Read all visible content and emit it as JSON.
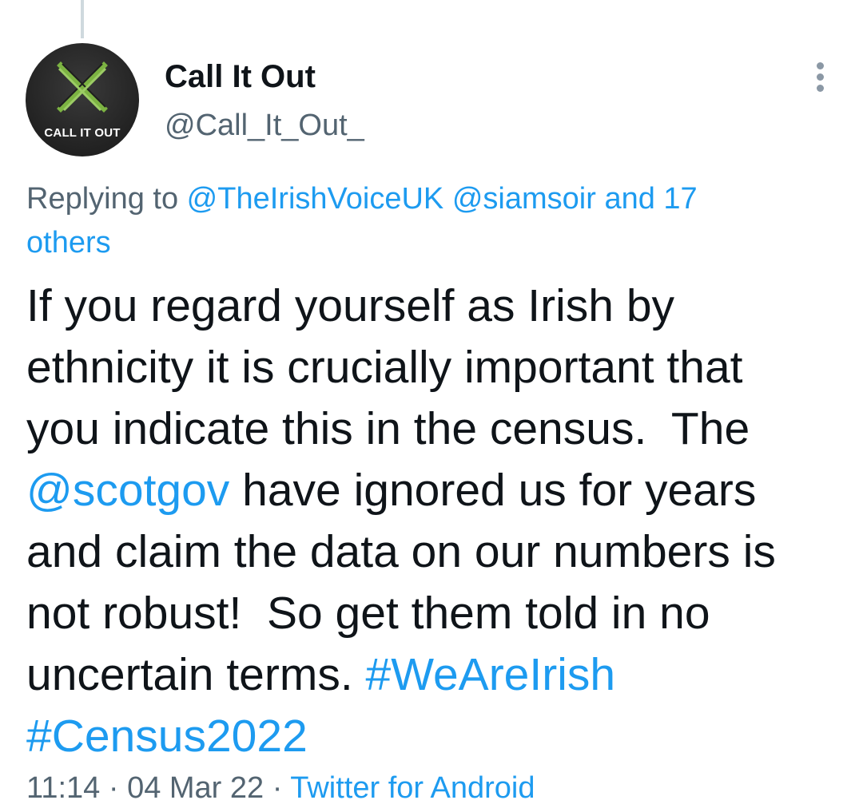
{
  "author": {
    "display_name": "Call It Out",
    "handle": "@Call_It_Out_",
    "avatar_caption": "CALL IT OUT",
    "avatar_icon": "x-logo-icon"
  },
  "menu": {
    "icon": "more-vertical-icon"
  },
  "replying": {
    "prefix": "Replying to ",
    "mention_1": "@TheIrishVoiceUK",
    "mention_2": "@siamsoir",
    "others_line1": "and 17",
    "others_line2": "others"
  },
  "tweet": {
    "line1": "If you regard yourself as Irish by",
    "line2": "ethnicity it is crucially important that",
    "line3": "you indicate this in the census.  The",
    "mention_scotgov": "@scotgov",
    "line4_rest": " have ignored us for years",
    "line5": "and claim the data on our numbers is",
    "line6": "not robust!  So get them told in no",
    "line7_text": "uncertain terms. ",
    "hashtag_1": "#WeAreIrish",
    "hashtag_2": "#Census2022"
  },
  "meta": {
    "time": "11:14",
    "separator_1": " · ",
    "date": "04 Mar 22",
    "separator_2": " · ",
    "source": "Twitter for Android"
  },
  "colors": {
    "link": "#1d9bf0",
    "secondary_text": "#536471",
    "primary_text": "#0f1419",
    "avatar_green": "#8bc34a"
  }
}
